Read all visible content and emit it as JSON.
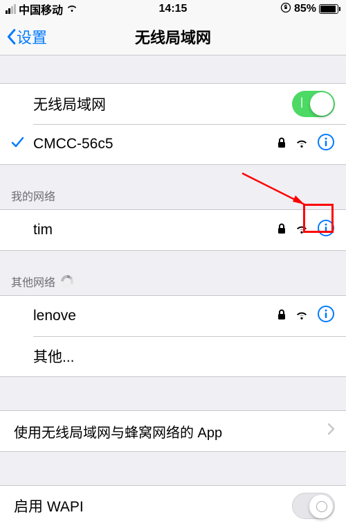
{
  "status": {
    "carrier": "中国移动",
    "time": "14:15",
    "battery_text": "85%"
  },
  "nav": {
    "back_label": "设置",
    "title": "无线局域网"
  },
  "wlan": {
    "toggle_label": "无线局域网",
    "toggle_on": true,
    "connected": {
      "name": "CMCC-56c5",
      "locked": true
    }
  },
  "sections": {
    "my_networks_header": "我的网络",
    "other_networks_header": "其他网络"
  },
  "my_networks": [
    {
      "name": "tim",
      "locked": true
    }
  ],
  "other_networks": [
    {
      "name": "lenove",
      "locked": true
    },
    {
      "name": "其他...",
      "locked": false,
      "no_icons": true
    }
  ],
  "rows": {
    "apps_using": "使用无线局域网与蜂窝网络的 App",
    "wapi": "启用 WAPI"
  },
  "colors": {
    "accent": "#007aff",
    "toggle_on": "#4cd964",
    "annotation": "#ff0000"
  }
}
